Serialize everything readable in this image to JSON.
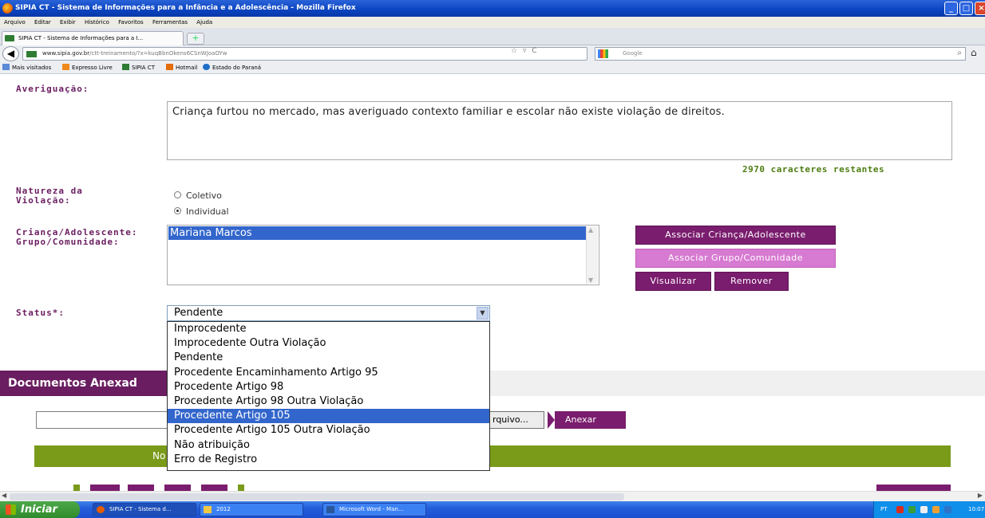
{
  "window": {
    "title": "SIPIA CT - Sistema de Informações para a Infância e a Adolescência - Mozilla Firefox"
  },
  "menu": [
    "Arquivo",
    "Editar",
    "Exibir",
    "Histórico",
    "Favoritos",
    "Ferramentas",
    "Ajuda"
  ],
  "tab": {
    "label": "SIPIA CT - Sistema de Informações para a I..."
  },
  "nav": {
    "url_host": "www.sipia.gov.br",
    "url_path": "/ctt-treinamento/?x=kuqBbnOkens6CSnWJoaOYw",
    "search_placeholder": "Google"
  },
  "bookmarks": [
    "Mais visitados",
    "Expresso Livre",
    "SIPIA CT",
    "Hotmail",
    "Estado do Paraná"
  ],
  "form": {
    "averiguacao_label": "Averiguação:",
    "averiguacao_text": "Criança furtou no mercado, mas averiguado contexto familiar e escolar não existe violação de direitos.",
    "counter": "2970 caracteres restantes",
    "natureza_label_1": "Natureza da",
    "natureza_label_2": "Violação:",
    "natureza_options": [
      "Coletivo",
      "Individual"
    ],
    "natureza_selected": "Individual",
    "crianca_label_1": "Criança/Adolescente:",
    "crianca_label_2": "Grupo/Comunidade:",
    "crianca_selected": "Mariana Marcos",
    "btn_associar_crianca": "Associar Criança/Adolescente",
    "btn_associar_grupo": "Associar Grupo/Comunidade",
    "btn_visualizar": "Visualizar",
    "btn_remover": "Remover",
    "status_label": "Status*:",
    "status_value": "Pendente",
    "status_options": [
      "Improcedente",
      "Improcedente Outra Violação",
      "Pendente",
      "Procedente Encaminhamento Artigo 95",
      "Procedente Artigo 98",
      "Procedente Artigo 98 Outra Violação",
      "Procedente Artigo 105",
      "Procedente Artigo 105 Outra Violação",
      "Não atribuição",
      "Erro de Registro"
    ],
    "status_highlighted": "Procedente Artigo 105"
  },
  "documentos": {
    "title": "Documentos Anexad",
    "browse_label": "rquivo...",
    "attach_label": "Anexar",
    "green_bar_text": "No"
  },
  "taskbar": {
    "start": "Iniciar",
    "items": [
      "SIPIA CT - Sistema d...",
      "2012",
      "Microsoft Word - Man..."
    ],
    "lang": "PT",
    "clock": "10:07"
  },
  "colors": {
    "label_purple": "#6a1d60",
    "button_purple": "#7a1d6e",
    "button_light": "#d77ad1",
    "counter_green": "#4e7d12",
    "bar_green": "#7a9a1a",
    "selection_blue": "#3366cc"
  }
}
